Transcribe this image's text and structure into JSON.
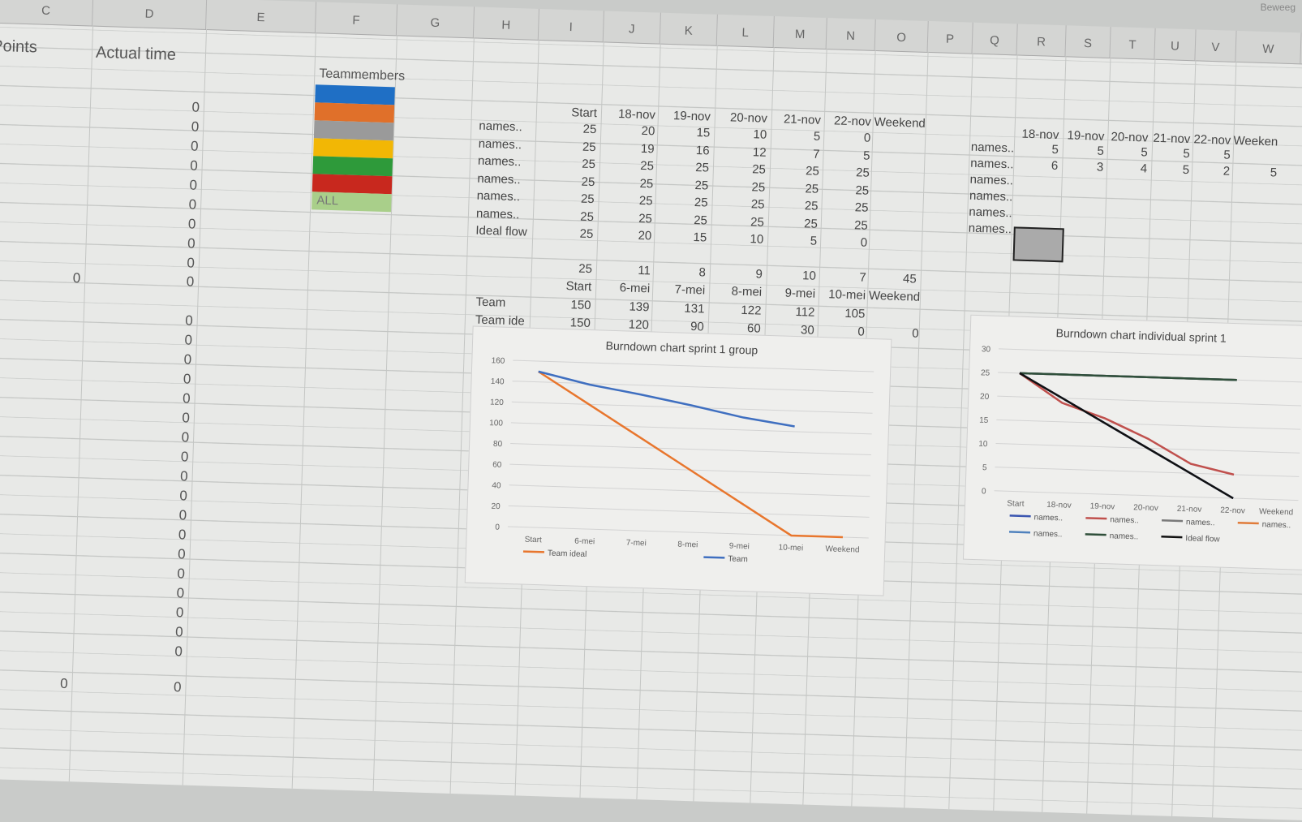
{
  "columns": [
    "C",
    "D",
    "E",
    "F",
    "G",
    "H",
    "I",
    "J",
    "K",
    "L",
    "M",
    "N",
    "O",
    "P",
    "Q",
    "R",
    "S",
    "T",
    "U",
    "V",
    "W"
  ],
  "corner_text": "Beweeg",
  "headers": {
    "points": "Points",
    "actual_time": "Actual time"
  },
  "actual_time_block1": [
    "0",
    "0",
    "0",
    "0",
    "0",
    "0",
    "0",
    "0",
    "0"
  ],
  "block1_total": {
    "points": "0",
    "actual": "0"
  },
  "actual_time_block2": [
    "0",
    "0",
    "0",
    "0",
    "0",
    "0",
    "0",
    "0",
    "0",
    "0",
    "0",
    "0",
    "0",
    "0",
    "0",
    "0",
    "0",
    "0"
  ],
  "block2_total": {
    "points": "0",
    "actual": "0"
  },
  "teammembers": {
    "title": "Teammembers",
    "all_label": "ALL",
    "colors": [
      "#1f6fc5",
      "#e0702a",
      "#9a9a9a",
      "#f2b705",
      "#2e9a3a",
      "#c8281e",
      "#a9cf8a"
    ]
  },
  "individual_table": {
    "headers": [
      "Start",
      "18-nov",
      "19-nov",
      "20-nov",
      "21-nov",
      "22-nov",
      "Weekend"
    ],
    "rows": [
      {
        "label": "names..",
        "values": [
          "25",
          "20",
          "15",
          "10",
          "5",
          "0"
        ]
      },
      {
        "label": "names..",
        "values": [
          "25",
          "19",
          "16",
          "12",
          "7",
          "5"
        ]
      },
      {
        "label": "names..",
        "values": [
          "25",
          "25",
          "25",
          "25",
          "25",
          "25"
        ]
      },
      {
        "label": "names..",
        "values": [
          "25",
          "25",
          "25",
          "25",
          "25",
          "25"
        ]
      },
      {
        "label": "names..",
        "values": [
          "25",
          "25",
          "25",
          "25",
          "25",
          "25"
        ]
      },
      {
        "label": "names..",
        "values": [
          "25",
          "25",
          "25",
          "25",
          "25",
          "25"
        ]
      },
      {
        "label": "Ideal flow",
        "values": [
          "25",
          "20",
          "15",
          "10",
          "5",
          "0"
        ]
      }
    ]
  },
  "daily_totals": [
    "25",
    "11",
    "8",
    "9",
    "10",
    "7",
    "45"
  ],
  "team_table": {
    "headers": [
      "Start",
      "6-mei",
      "7-mei",
      "8-mei",
      "9-mei",
      "10-mei",
      "Weekend"
    ],
    "rows": [
      {
        "label": "Team",
        "values": [
          "150",
          "139",
          "131",
          "122",
          "112",
          "105",
          ""
        ]
      },
      {
        "label": "Team ide",
        "values": [
          "150",
          "120",
          "90",
          "60",
          "30",
          "0",
          "0"
        ]
      }
    ]
  },
  "hours_table": {
    "headers": [
      "18-nov",
      "19-nov",
      "20-nov",
      "21-nov",
      "22-nov",
      "Weeken"
    ],
    "rows": [
      {
        "label": "names..",
        "values": [
          "5",
          "5",
          "5",
          "5",
          "5",
          ""
        ]
      },
      {
        "label": "names..",
        "values": [
          "6",
          "3",
          "4",
          "5",
          "2",
          "5"
        ]
      },
      {
        "label": "names..",
        "values": []
      },
      {
        "label": "names..",
        "values": []
      },
      {
        "label": "names..",
        "values": []
      },
      {
        "label": "names..",
        "values": []
      }
    ]
  },
  "chart_data": [
    {
      "type": "line",
      "title": "Burndown chart sprint 1 group",
      "categories": [
        "Start",
        "6-mei",
        "7-mei",
        "8-mei",
        "9-mei",
        "10-mei",
        "Weekend"
      ],
      "ylim": [
        0,
        160
      ],
      "yticks": [
        "0",
        "20",
        "40",
        "60",
        "80",
        "100",
        "120",
        "140",
        "160"
      ],
      "series": [
        {
          "name": "Team ideal",
          "color": "#e8762d",
          "values": [
            150,
            120,
            90,
            60,
            30,
            0,
            0
          ]
        },
        {
          "name": "Team",
          "color": "#3f6fc0",
          "values": [
            150,
            139,
            131,
            122,
            112,
            105,
            null
          ]
        }
      ],
      "legend": "bottom",
      "grid": true
    },
    {
      "type": "line",
      "title": "Burndown chart individual sprint 1",
      "categories": [
        "Start",
        "18-nov",
        "19-nov",
        "20-nov",
        "21-nov",
        "22-nov",
        "Weekend"
      ],
      "ylim": [
        0,
        30
      ],
      "yticks": [
        "0",
        "5",
        "10",
        "15",
        "20",
        "25",
        "30"
      ],
      "series": [
        {
          "name": "names..",
          "color": "#3a55b0",
          "values": [
            25,
            20,
            15,
            10,
            5,
            0
          ]
        },
        {
          "name": "names..",
          "color": "#c0504d",
          "values": [
            25,
            19,
            16,
            12,
            7,
            5
          ]
        },
        {
          "name": "names..",
          "color": "#7a7a7a",
          "values": [
            25,
            25,
            25,
            25,
            25,
            25
          ]
        },
        {
          "name": "names..",
          "color": "#e07b39",
          "values": [
            25,
            25,
            25,
            25,
            25,
            25
          ]
        },
        {
          "name": "names..",
          "color": "#4f81bd",
          "values": [
            25,
            25,
            25,
            25,
            25,
            25
          ]
        },
        {
          "name": "names..",
          "color": "#2f4f3a",
          "values": [
            25,
            25,
            25,
            25,
            25,
            25
          ]
        },
        {
          "name": "Ideal flow",
          "color": "#111111",
          "values": [
            25,
            20,
            15,
            10,
            5,
            0
          ]
        }
      ],
      "legend": "bottom",
      "grid": true
    }
  ]
}
